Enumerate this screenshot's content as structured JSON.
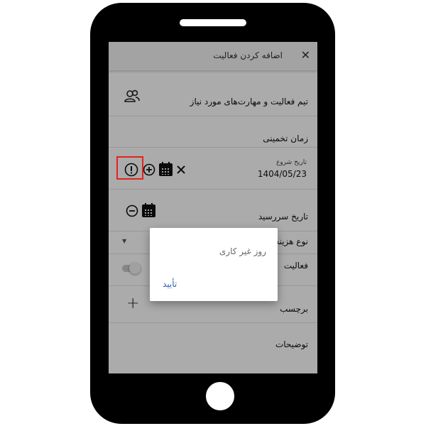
{
  "header": {
    "title": "اضافه کردن فعالیت",
    "close_icon": "close-icon"
  },
  "rows": {
    "team": {
      "label": "تیم فعالیت و مهارت‌های مورد نیاز",
      "icon": "team-icon"
    },
    "estimate": {
      "label": "زمان تخمینی"
    },
    "start": {
      "caption": "تاریخ شروع",
      "value": "1404/05/23"
    },
    "due": {
      "label": "تاریخ سررسید"
    },
    "cost": {
      "label": "نوع هزینه"
    },
    "active": {
      "label": "فعالیت"
    },
    "tag": {
      "label": "برچسب"
    },
    "description": {
      "label": "توضیحات"
    }
  },
  "dialog": {
    "message": "روز غیر کاری",
    "confirm_label": "تأیید"
  },
  "colors": {
    "highlight": "#e52121",
    "link": "#2a5fb0"
  }
}
